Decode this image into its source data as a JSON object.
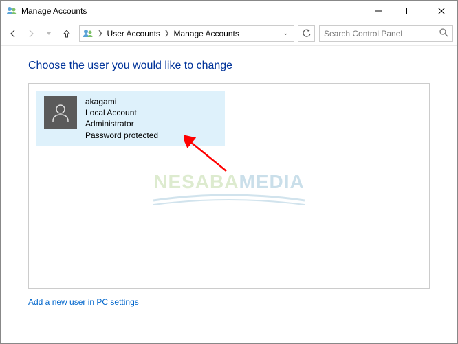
{
  "window": {
    "title": "Manage Accounts"
  },
  "nav": {
    "breadcrumb": {
      "item1": "User Accounts",
      "item2": "Manage Accounts"
    }
  },
  "search": {
    "placeholder": "Search Control Panel"
  },
  "page": {
    "heading": "Choose the user you would like to change",
    "new_user_link": "Add a new user in PC settings"
  },
  "accounts": [
    {
      "name": "akagami",
      "type": "Local Account",
      "role": "Administrator",
      "protection": "Password protected"
    }
  ],
  "watermark": {
    "part1": "NESABA",
    "part2": "MEDIA"
  }
}
